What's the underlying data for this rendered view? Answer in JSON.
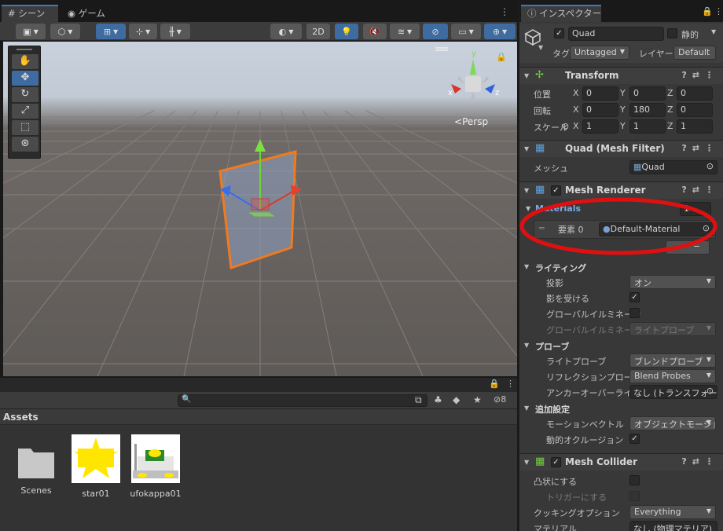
{
  "scene_tabs": {
    "scene": "シーン",
    "game": "ゲーム"
  },
  "toolbar": {
    "mode_2d": "2D"
  },
  "viewport": {
    "persp_label": "Persp",
    "gizmo_axes": {
      "y": "y",
      "x": "x",
      "z": "z"
    }
  },
  "project": {
    "assets_label": "Assets",
    "hidden_count": "8",
    "items": [
      {
        "name": "Scenes"
      },
      {
        "name": "star01"
      },
      {
        "name": "ufokappa01"
      }
    ]
  },
  "inspector": {
    "tab": "インスペクター",
    "object": {
      "name": "Quad",
      "static_label": "静的",
      "tag_label": "タグ",
      "tag_value": "Untagged",
      "layer_label": "レイヤー",
      "layer_value": "Default"
    },
    "transform": {
      "title": "Transform",
      "position_label": "位置",
      "rotation_label": "回転",
      "scale_label": "スケール",
      "position": {
        "x": "0",
        "y": "0",
        "z": "0"
      },
      "rotation": {
        "x": "0",
        "y": "180",
        "z": "0"
      },
      "scale": {
        "x": "1",
        "y": "1",
        "z": "1"
      },
      "axis_x": "X",
      "axis_y": "Y",
      "axis_z": "Z"
    },
    "mesh_filter": {
      "title": "Quad (Mesh Filter)",
      "mesh_label": "メッシュ",
      "mesh_value": "Quad"
    },
    "mesh_renderer": {
      "title": "Mesh Renderer",
      "materials_label": "Materials",
      "materials_count": "1",
      "element_label": "要素 0",
      "element_value": "Default-Material",
      "remove_label": "−"
    },
    "lighting": {
      "header": "ライティング",
      "cast_shadows_label": "投影",
      "cast_shadows_value": "オン",
      "receive_shadows_label": "影を受ける",
      "gi_label": "グローバルイルミネーシ",
      "gi2_label": "グローバルイルミネーシ",
      "gi2_value": "ライトプローブ"
    },
    "probes": {
      "header": "プローブ",
      "light_probes_label": "ライトプローブ",
      "light_probes_value": "ブレンドプローブ",
      "reflection_label": "リフレクションプローブ",
      "reflection_value": "Blend Probes",
      "anchor_label": "アンカーオーバーライド",
      "anchor_value": "なし (トランスフォー..."
    },
    "additional": {
      "header": "追加設定",
      "motion_label": "モーションベクトル",
      "motion_value": "オブジェクトモーション",
      "occlusion_label": "動的オクルージョン"
    },
    "mesh_collider": {
      "title": "Mesh Collider",
      "convex_label": "凸状にする",
      "trigger_label": "トリガーにする",
      "cooking_label": "クッキングオプション",
      "cooking_value": "Everything",
      "material_label": "マテリアル",
      "material_value": "なし (物理マテリア)"
    }
  },
  "colors": {
    "accent_blue": "#3e6ca0",
    "annotation_red": "#e01010",
    "selection_orange": "#f07a20"
  }
}
